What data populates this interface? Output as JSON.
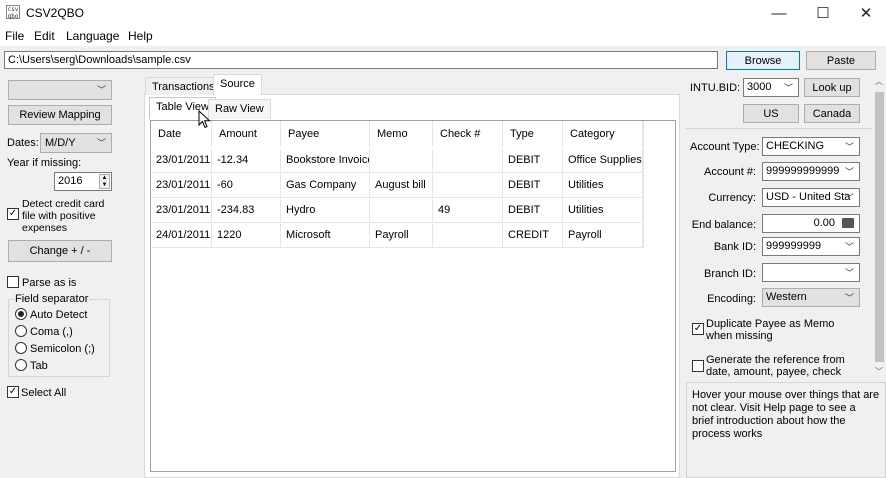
{
  "window": {
    "title": "CSV2QBO",
    "app_icon_text": "csv\nqbo",
    "minimize": "—",
    "maximize": "☐",
    "close": "✕"
  },
  "menu": [
    "File",
    "Edit",
    "Language",
    "Help"
  ],
  "path": {
    "value": "C:\\Users\\serg\\Downloads\\sample.csv",
    "browse_label": "Browse",
    "paste_label": "Paste"
  },
  "left": {
    "top_combo_value": "",
    "review_mapping_label": "Review Mapping",
    "dates_label": "Dates:",
    "dates_value": "M/D/Y",
    "year_missing_label": "Year if missing:",
    "year_value": "2016",
    "detect_credit_label": "Detect credit card file with positive expenses",
    "detect_credit_checked": true,
    "change_label": "Change + / -",
    "parse_as_is_label": "Parse as is",
    "parse_as_is_checked": false,
    "field_separator_label": "Field separator",
    "separators": [
      {
        "label": "Auto Detect",
        "selected": true
      },
      {
        "label": "Coma (,)",
        "selected": false
      },
      {
        "label": "Semicolon (;)",
        "selected": false
      },
      {
        "label": "Tab",
        "selected": false
      }
    ],
    "select_all_label": "Select All",
    "select_all_checked": true
  },
  "tabs": {
    "outer": [
      {
        "label": "Transactions",
        "active": false
      },
      {
        "label": "Source",
        "active": true
      }
    ],
    "inner": [
      {
        "label": "Table View",
        "active": true
      },
      {
        "label": "Raw View",
        "active": false
      }
    ]
  },
  "table": {
    "columns": [
      "Date",
      "Amount",
      "Payee",
      "Memo",
      "Check #",
      "Type",
      "Category"
    ],
    "rows": [
      [
        "23/01/2011",
        "-12.34",
        "Bookstore Invoice",
        "",
        "",
        "DEBIT",
        "Office Supplies"
      ],
      [
        "23/01/2011",
        "-60",
        "Gas Company",
        "August bill",
        "",
        "DEBIT",
        "Utilities"
      ],
      [
        "23/01/2011",
        "-234.83",
        "Hydro",
        "",
        "49",
        "DEBIT",
        "Utilities"
      ],
      [
        "24/01/2011",
        "1220",
        "Microsoft",
        "Payroll",
        "",
        "CREDIT",
        "Payroll"
      ]
    ]
  },
  "right": {
    "intu_bid_label": "INTU.BID:",
    "intu_bid_value": "3000",
    "lookup_label": "Look up",
    "us_label": "US",
    "canada_label": "Canada",
    "account_type_label": "Account Type:",
    "account_type_value": "CHECKING",
    "account_num_label": "Account #:",
    "account_num_value": "999999999999",
    "currency_label": "Currency:",
    "currency_value": "USD - United Sta",
    "end_balance_label": "End balance:",
    "end_balance_value": "0.00",
    "bank_id_label": "Bank ID:",
    "bank_id_value": "999999999",
    "branch_id_label": "Branch ID:",
    "branch_id_value": "",
    "encoding_label": "Encoding:",
    "encoding_value": "Western",
    "dup_payee_label": "Duplicate Payee as Memo when missing",
    "dup_payee_checked": true,
    "gen_ref_label": "Generate the reference from date, amount, payee, check",
    "gen_ref_checked": false
  },
  "help_text": "Hover your mouse over things that are not clear. Visit Help page to see a brief introduction about how the process works"
}
